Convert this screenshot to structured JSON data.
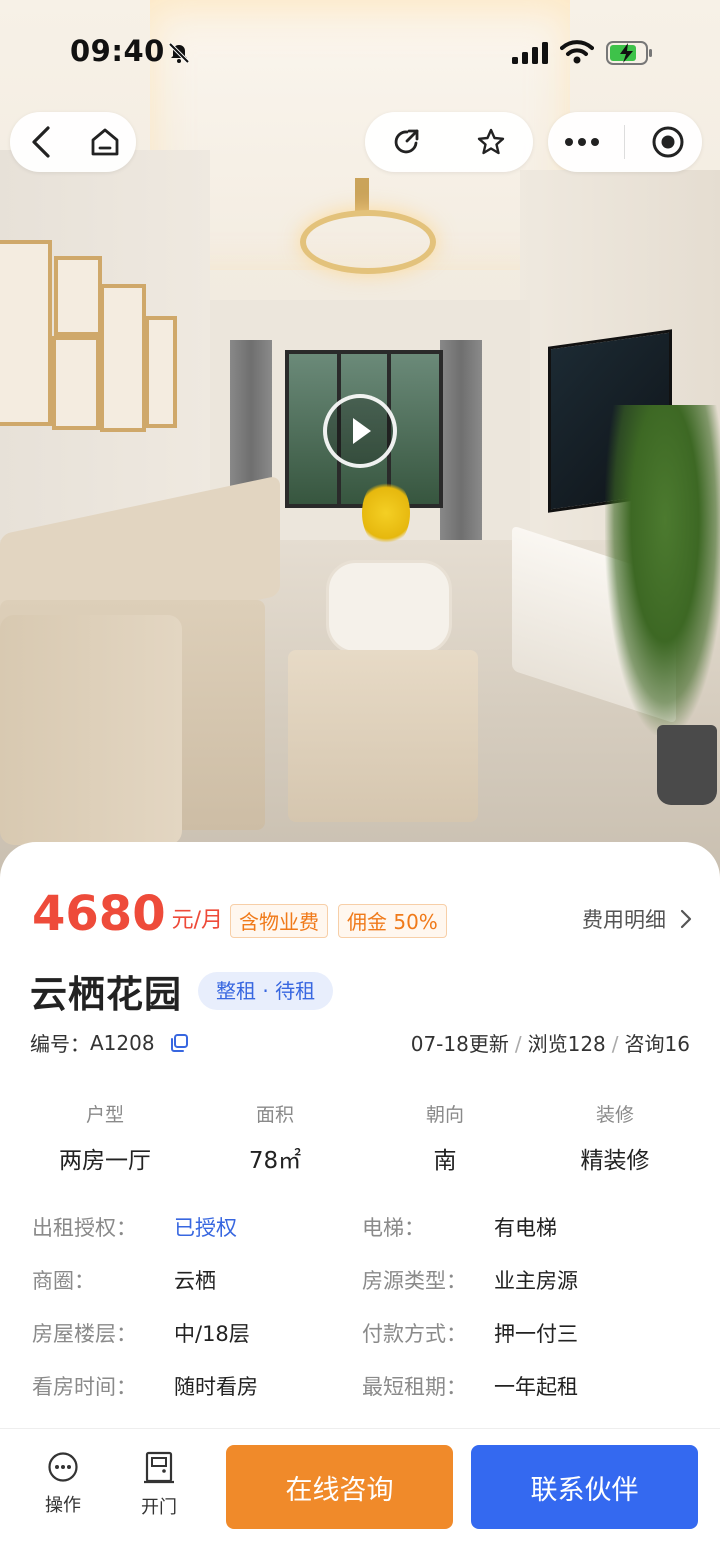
{
  "status_bar": {
    "time": "09:40"
  },
  "capsule": {
    "icons": [
      "back-icon",
      "home-icon",
      "share-icon",
      "star-icon",
      "more-icon",
      "target-icon"
    ]
  },
  "listing": {
    "price": "4680",
    "price_unit": "元/月",
    "tags": [
      "含物业费",
      "佣金 50%"
    ],
    "fee_detail_label": "费用明细",
    "title": "云栖花园",
    "rent_status": "整租 · 待租",
    "id_label": "编号：",
    "id_value": "A1208",
    "updated": "07-18更新",
    "views": "浏览128",
    "consults": "咨询16"
  },
  "specs": [
    {
      "label": "户型",
      "value": "两房一厅"
    },
    {
      "label": "面积",
      "value": "78㎡"
    },
    {
      "label": "朝向",
      "value": "南"
    },
    {
      "label": "装修",
      "value": "精装修"
    }
  ],
  "details": [
    {
      "left_label": "出租授权：",
      "left_value": "已授权",
      "right_label": "电梯：",
      "right_value": "有电梯"
    },
    {
      "left_label": "商圈：",
      "left_value": "云栖",
      "right_label": "房源类型：",
      "right_value": "业主房源"
    },
    {
      "left_label": "房屋楼层：",
      "left_value": "中/18层",
      "right_label": "付款方式：",
      "right_value": "押一付三"
    },
    {
      "left_label": "看房时间：",
      "left_value": "随时看房",
      "right_label": "最短租期：",
      "right_value": "一年起租"
    }
  ],
  "bottom_bar": {
    "operate_label": "操作",
    "door_label": "开门",
    "consult_label": "在线咨询",
    "partner_label": "联系伙伴"
  },
  "colors": {
    "price": "#ee4b3a",
    "accent_blue": "#3469f0",
    "accent_orange": "#f08a2a"
  }
}
